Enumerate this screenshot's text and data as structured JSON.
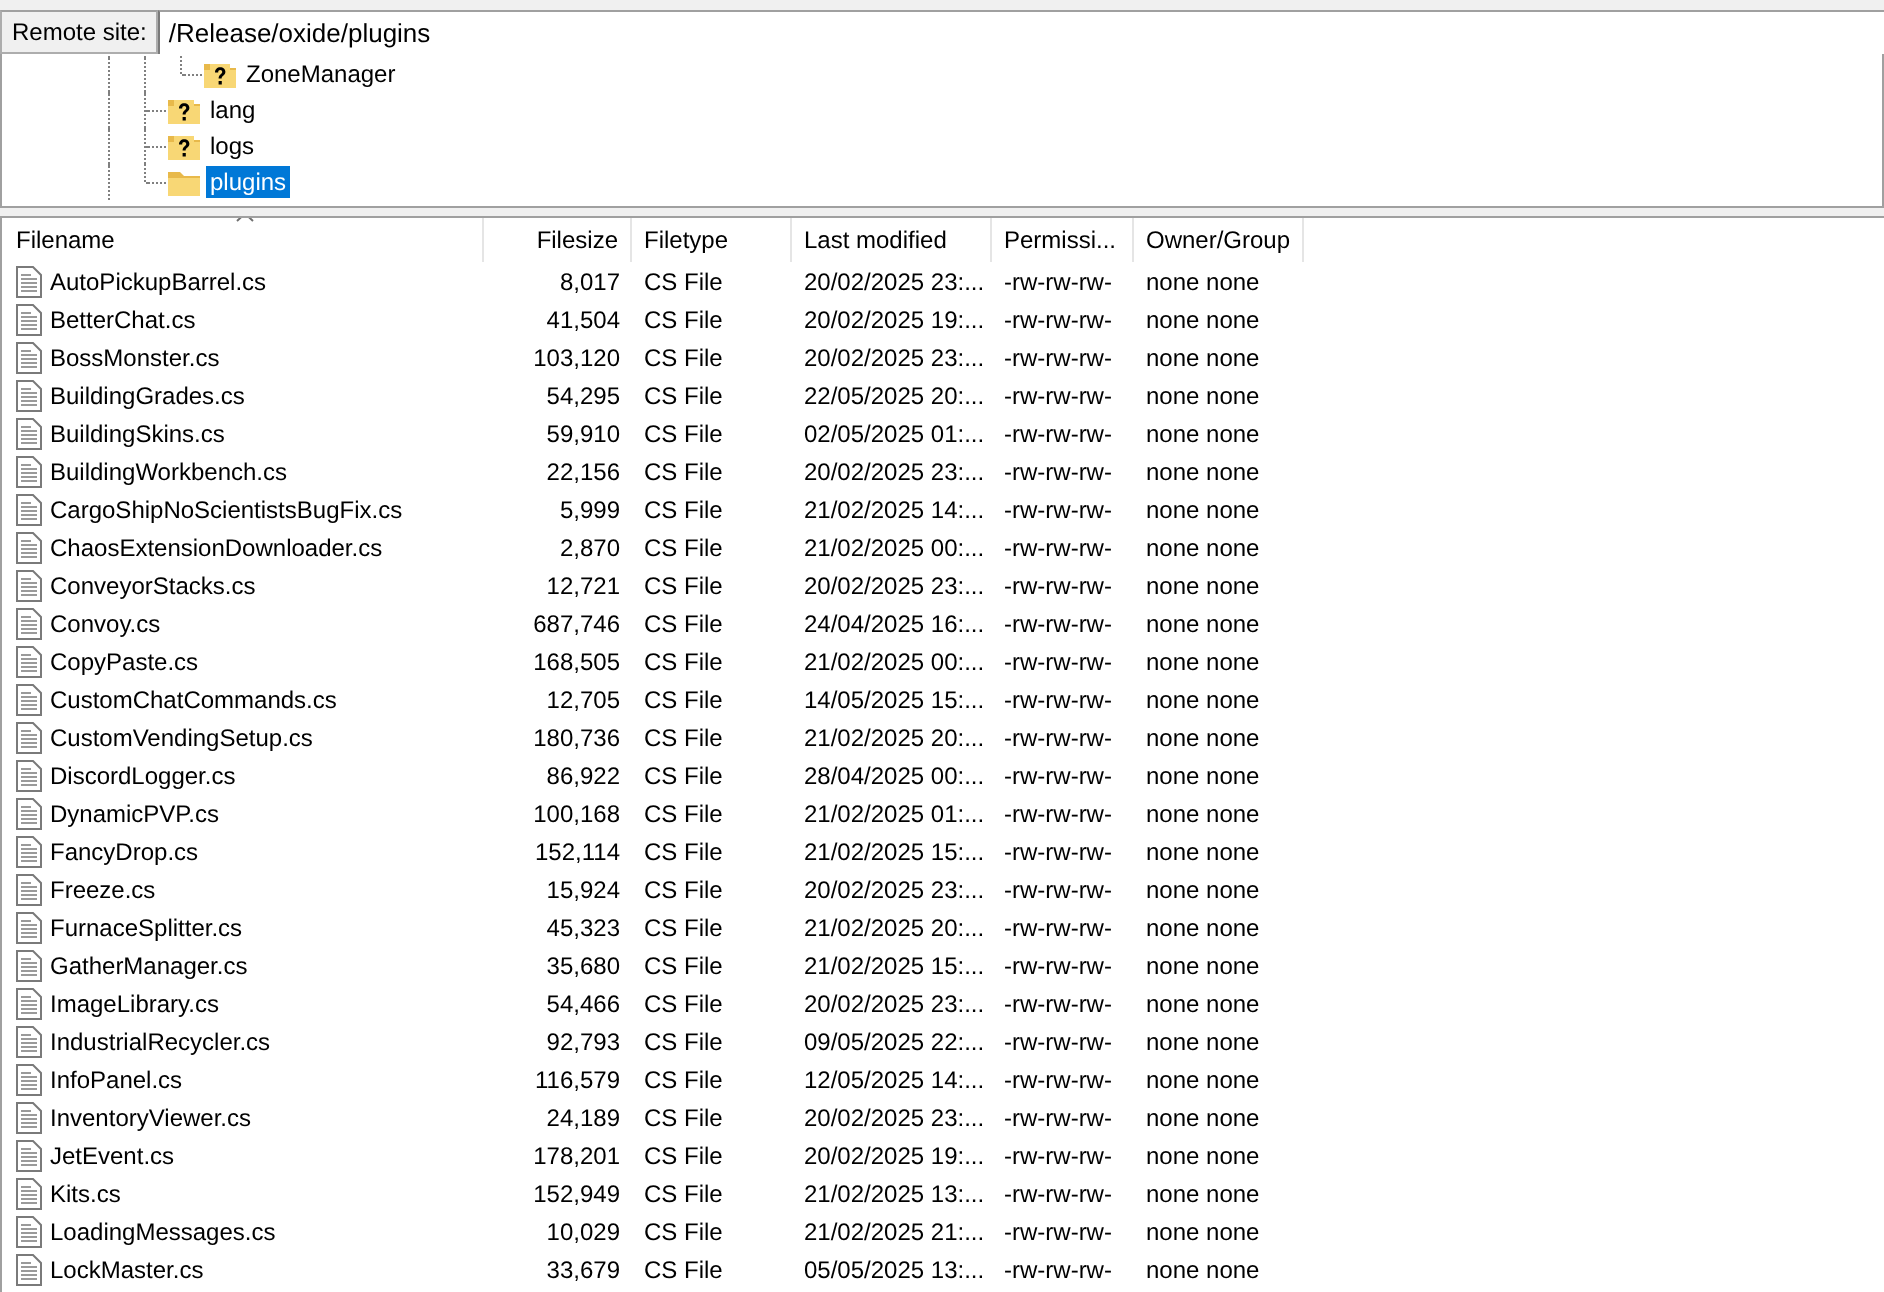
{
  "site_bar": {
    "label": "Remote site:",
    "value": "/Release/oxide/plugins"
  },
  "tree": {
    "partial_branch": [
      {
        "label": "ZoneManager",
        "kind": "unknown",
        "selected": false
      }
    ],
    "items": [
      {
        "label": "lang",
        "kind": "unknown",
        "selected": false
      },
      {
        "label": "logs",
        "kind": "unknown",
        "selected": false
      },
      {
        "label": "plugins",
        "kind": "folder",
        "selected": true
      }
    ]
  },
  "file_list": {
    "columns": [
      {
        "label": "Filename",
        "kind": "name",
        "sorted": true
      },
      {
        "label": "Filesize",
        "kind": "number",
        "sorted": false
      },
      {
        "label": "Filetype",
        "kind": "text",
        "sorted": false
      },
      {
        "label": "Last modified",
        "kind": "text",
        "sorted": false
      },
      {
        "label": "Permissi...",
        "kind": "text",
        "sorted": false
      },
      {
        "label": "Owner/Group",
        "kind": "text",
        "sorted": false
      }
    ],
    "rows": [
      [
        "AutoPickupBarrel.cs",
        "8,017",
        "CS File",
        "20/02/2025 23:...",
        "-rw-rw-rw-",
        "none none"
      ],
      [
        "BetterChat.cs",
        "41,504",
        "CS File",
        "20/02/2025 19:...",
        "-rw-rw-rw-",
        "none none"
      ],
      [
        "BossMonster.cs",
        "103,120",
        "CS File",
        "20/02/2025 23:...",
        "-rw-rw-rw-",
        "none none"
      ],
      [
        "BuildingGrades.cs",
        "54,295",
        "CS File",
        "22/05/2025 20:...",
        "-rw-rw-rw-",
        "none none"
      ],
      [
        "BuildingSkins.cs",
        "59,910",
        "CS File",
        "02/05/2025 01:...",
        "-rw-rw-rw-",
        "none none"
      ],
      [
        "BuildingWorkbench.cs",
        "22,156",
        "CS File",
        "20/02/2025 23:...",
        "-rw-rw-rw-",
        "none none"
      ],
      [
        "CargoShipNoScientistsBugFix.cs",
        "5,999",
        "CS File",
        "21/02/2025 14:...",
        "-rw-rw-rw-",
        "none none"
      ],
      [
        "ChaosExtensionDownloader.cs",
        "2,870",
        "CS File",
        "21/02/2025 00:...",
        "-rw-rw-rw-",
        "none none"
      ],
      [
        "ConveyorStacks.cs",
        "12,721",
        "CS File",
        "20/02/2025 23:...",
        "-rw-rw-rw-",
        "none none"
      ],
      [
        "Convoy.cs",
        "687,746",
        "CS File",
        "24/04/2025 16:...",
        "-rw-rw-rw-",
        "none none"
      ],
      [
        "CopyPaste.cs",
        "168,505",
        "CS File",
        "21/02/2025 00:...",
        "-rw-rw-rw-",
        "none none"
      ],
      [
        "CustomChatCommands.cs",
        "12,705",
        "CS File",
        "14/05/2025 15:...",
        "-rw-rw-rw-",
        "none none"
      ],
      [
        "CustomVendingSetup.cs",
        "180,736",
        "CS File",
        "21/02/2025 20:...",
        "-rw-rw-rw-",
        "none none"
      ],
      [
        "DiscordLogger.cs",
        "86,922",
        "CS File",
        "28/04/2025 00:...",
        "-rw-rw-rw-",
        "none none"
      ],
      [
        "DynamicPVP.cs",
        "100,168",
        "CS File",
        "21/02/2025 01:...",
        "-rw-rw-rw-",
        "none none"
      ],
      [
        "FancyDrop.cs",
        "152,114",
        "CS File",
        "21/02/2025 15:...",
        "-rw-rw-rw-",
        "none none"
      ],
      [
        "Freeze.cs",
        "15,924",
        "CS File",
        "20/02/2025 23:...",
        "-rw-rw-rw-",
        "none none"
      ],
      [
        "FurnaceSplitter.cs",
        "45,323",
        "CS File",
        "21/02/2025 20:...",
        "-rw-rw-rw-",
        "none none"
      ],
      [
        "GatherManager.cs",
        "35,680",
        "CS File",
        "21/02/2025 15:...",
        "-rw-rw-rw-",
        "none none"
      ],
      [
        "ImageLibrary.cs",
        "54,466",
        "CS File",
        "20/02/2025 23:...",
        "-rw-rw-rw-",
        "none none"
      ],
      [
        "IndustrialRecycler.cs",
        "92,793",
        "CS File",
        "09/05/2025 22:...",
        "-rw-rw-rw-",
        "none none"
      ],
      [
        "InfoPanel.cs",
        "116,579",
        "CS File",
        "12/05/2025 14:...",
        "-rw-rw-rw-",
        "none none"
      ],
      [
        "InventoryViewer.cs",
        "24,189",
        "CS File",
        "20/02/2025 23:...",
        "-rw-rw-rw-",
        "none none"
      ],
      [
        "JetEvent.cs",
        "178,201",
        "CS File",
        "20/02/2025 19:...",
        "-rw-rw-rw-",
        "none none"
      ],
      [
        "Kits.cs",
        "152,949",
        "CS File",
        "21/02/2025 13:...",
        "-rw-rw-rw-",
        "none none"
      ],
      [
        "LoadingMessages.cs",
        "10,029",
        "CS File",
        "21/02/2025 21:...",
        "-rw-rw-rw-",
        "none none"
      ],
      [
        "LockMaster.cs",
        "33,679",
        "CS File",
        "05/05/2025 13:...",
        "-rw-rw-rw-",
        "none none"
      ]
    ]
  }
}
